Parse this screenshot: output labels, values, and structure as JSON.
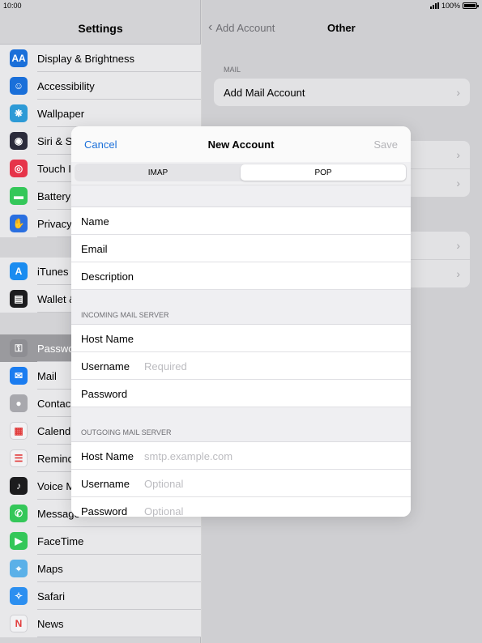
{
  "status_bar": {
    "time": "10:00",
    "battery": "100%",
    "battery_level": 1.0
  },
  "sidebar": {
    "title": "Settings",
    "groups": [
      {
        "items": [
          {
            "label": "Display & Brightness",
            "icon": "display-brightness-icon",
            "glyph": "AA",
            "color": "#1a6fd9"
          },
          {
            "label": "Accessibility",
            "icon": "accessibility-icon",
            "glyph": "☺",
            "color": "#1a6fd9"
          },
          {
            "label": "Wallpaper",
            "icon": "wallpaper-icon",
            "glyph": "❋",
            "color": "#2d9ad6"
          },
          {
            "label": "Siri & S",
            "icon": "siri-icon",
            "glyph": "◉",
            "color": "#2b2b3b"
          },
          {
            "label": "Touch I",
            "icon": "touch-id-icon",
            "glyph": "◎",
            "color": "#e6344a"
          },
          {
            "label": "Battery",
            "icon": "battery-icon",
            "glyph": "▬",
            "color": "#34c759"
          },
          {
            "label": "Privacy",
            "icon": "privacy-hand-icon",
            "glyph": "✋",
            "color": "#2a6fe0"
          }
        ]
      },
      {
        "items": [
          {
            "label": "iTunes",
            "icon": "itunes-store-icon",
            "glyph": "A",
            "color": "#1a8cf0"
          },
          {
            "label": "Wallet &",
            "icon": "wallet-icon",
            "glyph": "▤",
            "color": "#1c1c1e"
          }
        ]
      },
      {
        "items": [
          {
            "label": "Passwo",
            "icon": "passwords-key-icon",
            "glyph": "⚿",
            "color": "#8e8e93",
            "selected": true
          },
          {
            "label": "Mail",
            "icon": "mail-icon",
            "glyph": "✉",
            "color": "#1a7cf0"
          },
          {
            "label": "Contac",
            "icon": "contacts-icon",
            "glyph": "●",
            "color": "#a8a8ad"
          },
          {
            "label": "Calend",
            "icon": "calendar-icon",
            "glyph": "▦",
            "color": "#f2f2f4"
          },
          {
            "label": "Remind",
            "icon": "reminders-icon",
            "glyph": "☰",
            "color": "#f2f2f4"
          },
          {
            "label": "Voice M",
            "icon": "voice-memos-icon",
            "glyph": "♪",
            "color": "#1c1c1e"
          },
          {
            "label": "Message",
            "icon": "messages-icon",
            "glyph": "✆",
            "color": "#34c759"
          },
          {
            "label": "FaceTime",
            "icon": "facetime-icon",
            "glyph": "▶",
            "color": "#34c759"
          },
          {
            "label": "Maps",
            "icon": "maps-icon",
            "glyph": "⌖",
            "color": "#5ab0e8"
          },
          {
            "label": "Safari",
            "icon": "safari-icon",
            "glyph": "✧",
            "color": "#2c8ff0"
          },
          {
            "label": "News",
            "icon": "news-icon",
            "glyph": "N",
            "color": "#f2f2f4"
          }
        ]
      }
    ]
  },
  "detail": {
    "back_label": "Add Account",
    "title": "Other",
    "mail_header": "MAIL",
    "add_mail_label": "Add Mail Account"
  },
  "modal": {
    "cancel_label": "Cancel",
    "title": "New Account",
    "save_label": "Save",
    "segments": [
      {
        "label": "IMAP",
        "active": false
      },
      {
        "label": "POP",
        "active": true
      }
    ],
    "account_fields": [
      {
        "label": "Name",
        "placeholder": ""
      },
      {
        "label": "Email",
        "placeholder": ""
      },
      {
        "label": "Description",
        "placeholder": ""
      }
    ],
    "incoming_header": "INCOMING MAIL SERVER",
    "incoming_fields": [
      {
        "label": "Host Name",
        "placeholder": ""
      },
      {
        "label": "Username",
        "placeholder": "Required"
      },
      {
        "label": "Password",
        "placeholder": ""
      }
    ],
    "outgoing_header": "OUTGOING MAIL SERVER",
    "outgoing_fields": [
      {
        "label": "Host Name",
        "placeholder": "smtp.example.com"
      },
      {
        "label": "Username",
        "placeholder": "Optional"
      },
      {
        "label": "Password",
        "placeholder": "Optional"
      }
    ]
  }
}
